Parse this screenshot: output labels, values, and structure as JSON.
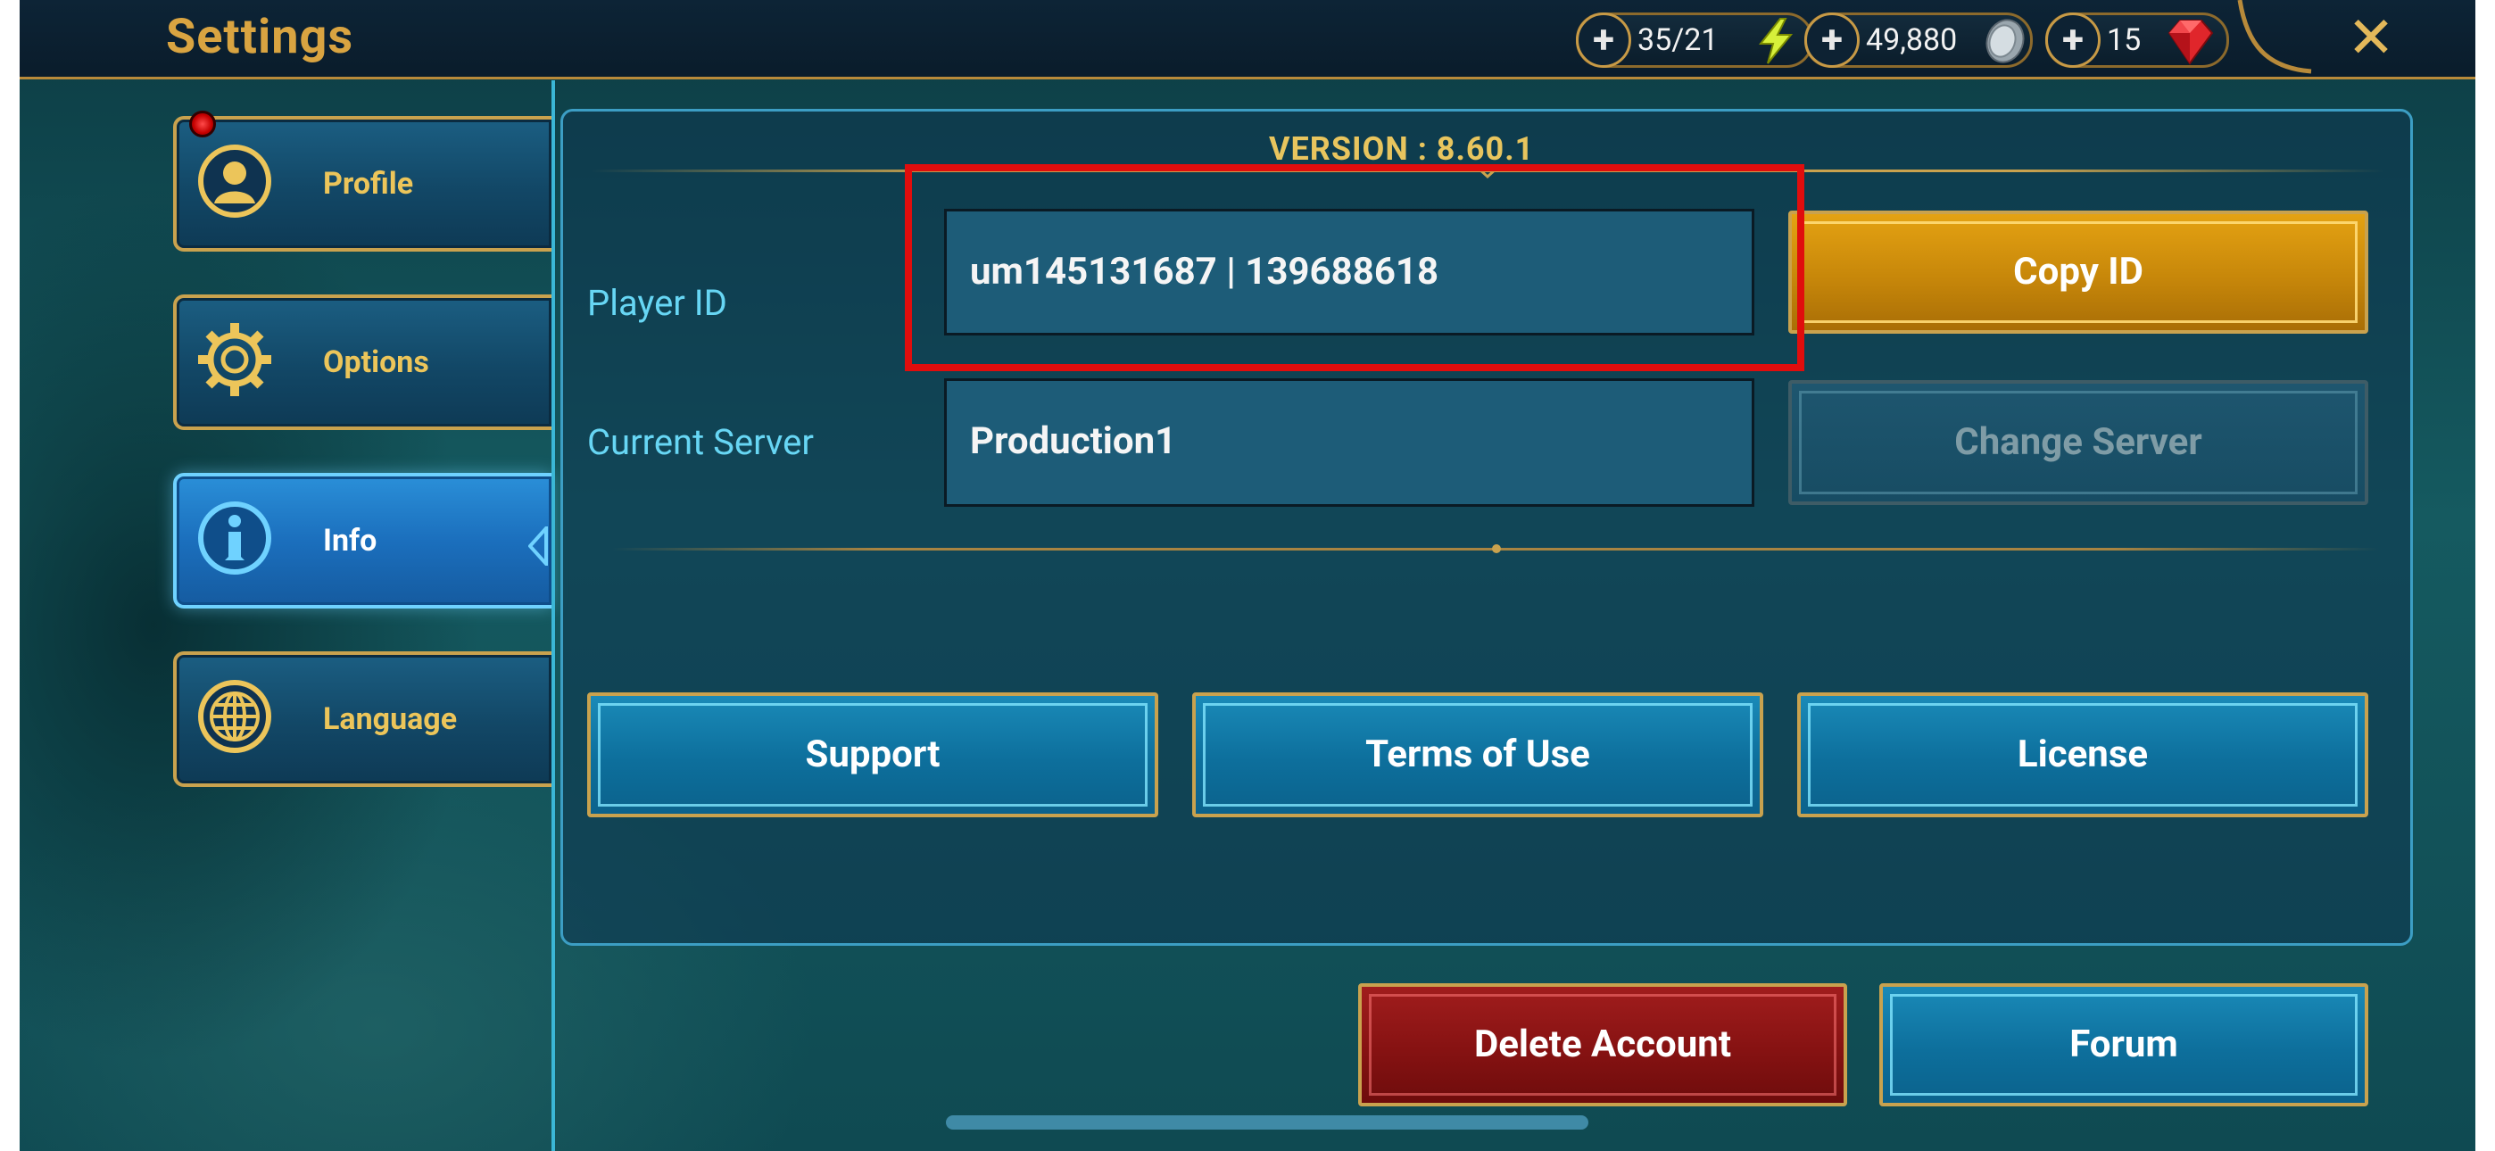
{
  "header": {
    "title": "Settings",
    "energy": "35/21",
    "silver": "49,880",
    "gems": "15",
    "plus_symbol": "+",
    "close_symbol": "✕"
  },
  "sidebar": {
    "items": [
      {
        "label": "Profile",
        "icon": "profile-icon",
        "has_notification": true
      },
      {
        "label": "Options",
        "icon": "gear-icon"
      },
      {
        "label": "Info",
        "icon": "info-icon",
        "active": true
      },
      {
        "label": "Language",
        "icon": "globe-icon"
      }
    ]
  },
  "info": {
    "version": "VERSION : 8.60.1",
    "player_id_label": "Player ID",
    "player_id_value": "um145131687 | 139688618",
    "server_label": "Current Server",
    "server_value": "Production1",
    "copy_button": "Copy ID",
    "change_server_button": "Change Server",
    "support_button": "Support",
    "terms_button": "Terms of Use",
    "license_button": "License"
  },
  "footer": {
    "delete_button": "Delete Account",
    "forum_button": "Forum"
  },
  "colors": {
    "gold": "#c9a24e",
    "title": "#d9a441",
    "label": "#67d6f4",
    "highlight": "#e00d0d",
    "copy_button": "#c7870a",
    "delete_button": "#861212"
  }
}
